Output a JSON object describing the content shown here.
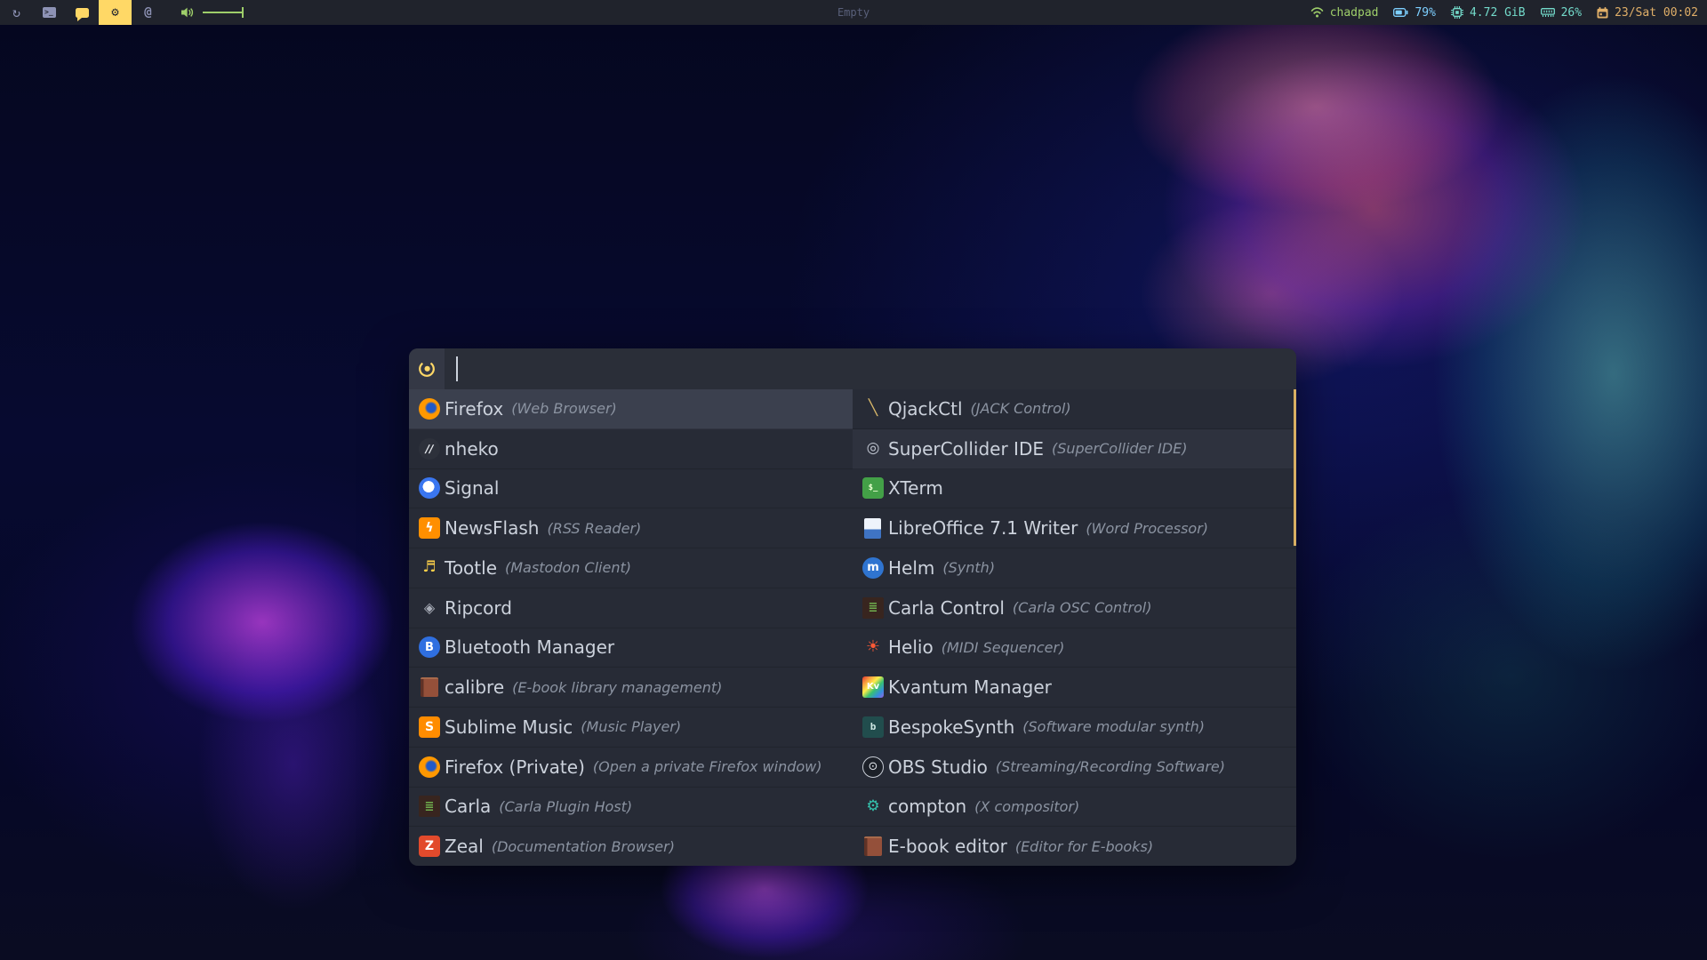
{
  "colors": {
    "accent": "#ffd866",
    "bar_bg": "#20232c",
    "launcher_bg": "#272b36",
    "selected_row_bg": "#3b404e",
    "item_text": "#ccd2dc",
    "item_desc": "#8b93a1",
    "green": "#9ece6a",
    "blue": "#7dcfff",
    "teal": "#73daca",
    "yellow": "#e0af68",
    "scrollbar": "#d8af63"
  },
  "topbar": {
    "window_title": "Empty",
    "workspace_glyphs": {
      "browser": "↻",
      "terminal": ">_",
      "gear": "⚙",
      "at": "@"
    },
    "workspaces": [
      {
        "id": "browser",
        "active": false
      },
      {
        "id": "terminal",
        "active": false
      },
      {
        "id": "chat",
        "active": false
      },
      {
        "id": "settings",
        "active": true
      },
      {
        "id": "social",
        "active": false
      }
    ],
    "status": [
      {
        "id": "network",
        "label": "chadpad",
        "color": "green"
      },
      {
        "id": "battery",
        "label": "79%",
        "color": "blue"
      },
      {
        "id": "memory",
        "label": "4.72 GiB",
        "color": "teal"
      },
      {
        "id": "cpu",
        "label": "26%",
        "color": "teal"
      },
      {
        "id": "date",
        "label": "23/Sat 00:02",
        "color": "yellow"
      }
    ]
  },
  "launcher": {
    "search_value": "",
    "icon_glyphs": {
      "firefox": "",
      "nheko": "∕∕",
      "signal": "",
      "newsflash": "ϟ",
      "tootle": "♬",
      "ripcord": "◈",
      "bluetooth": "B",
      "calibre": "",
      "sublime": "S",
      "firefox_private": "",
      "carla": "≣",
      "zeal": "Z",
      "qjackctl": "╲",
      "supercollider": "◎",
      "xterm": "$_",
      "writer": "",
      "helm": "m",
      "carla_control": "≣",
      "helio": "☀",
      "kvantum": "Kv",
      "bespoke": "b",
      "obs": "⊙",
      "compton": "⚙",
      "ebook": ""
    },
    "columns": [
      [
        {
          "icon": "firefox",
          "name": "Firefox",
          "desc": "(Web Browser)",
          "selected": true
        },
        {
          "icon": "nheko",
          "name": "nheko",
          "desc": ""
        },
        {
          "icon": "signal",
          "name": "Signal",
          "desc": ""
        },
        {
          "icon": "newsflash",
          "name": "NewsFlash",
          "desc": "(RSS Reader)"
        },
        {
          "icon": "tootle",
          "name": "Tootle",
          "desc": "(Mastodon Client)"
        },
        {
          "icon": "ripcord",
          "name": "Ripcord",
          "desc": ""
        },
        {
          "icon": "bluetooth",
          "name": "Bluetooth Manager",
          "desc": ""
        },
        {
          "icon": "calibre",
          "name": "calibre",
          "desc": "(E-book library management)"
        },
        {
          "icon": "sublime",
          "name": "Sublime Music",
          "desc": "(Music Player)"
        },
        {
          "icon": "firefox_private",
          "name": "Firefox (Private)",
          "desc": "(Open a private Firefox window)"
        },
        {
          "icon": "carla",
          "name": "Carla",
          "desc": "(Carla Plugin Host)"
        },
        {
          "icon": "zeal",
          "name": "Zeal",
          "desc": "(Documentation Browser)"
        }
      ],
      [
        {
          "icon": "qjackctl",
          "name": "QjackCtl",
          "desc": "(JACK Control)"
        },
        {
          "icon": "supercollider",
          "name": "SuperCollider IDE",
          "desc": "(SuperCollider IDE)",
          "hover": true
        },
        {
          "icon": "xterm",
          "name": "XTerm",
          "desc": ""
        },
        {
          "icon": "writer",
          "name": "LibreOffice 7.1 Writer",
          "desc": "(Word Processor)"
        },
        {
          "icon": "helm",
          "name": "Helm",
          "desc": "(Synth)"
        },
        {
          "icon": "carla_control",
          "name": "Carla Control",
          "desc": "(Carla OSC Control)"
        },
        {
          "icon": "helio",
          "name": "Helio",
          "desc": "(MIDI Sequencer)"
        },
        {
          "icon": "kvantum",
          "name": "Kvantum Manager",
          "desc": ""
        },
        {
          "icon": "bespoke",
          "name": "BespokeSynth",
          "desc": "(Software modular synth)"
        },
        {
          "icon": "obs",
          "name": "OBS Studio",
          "desc": "(Streaming/Recording Software)"
        },
        {
          "icon": "compton",
          "name": "compton",
          "desc": "(X compositor)"
        },
        {
          "icon": "ebook",
          "name": "E-book editor",
          "desc": "(Editor for E-books)"
        }
      ]
    ]
  }
}
